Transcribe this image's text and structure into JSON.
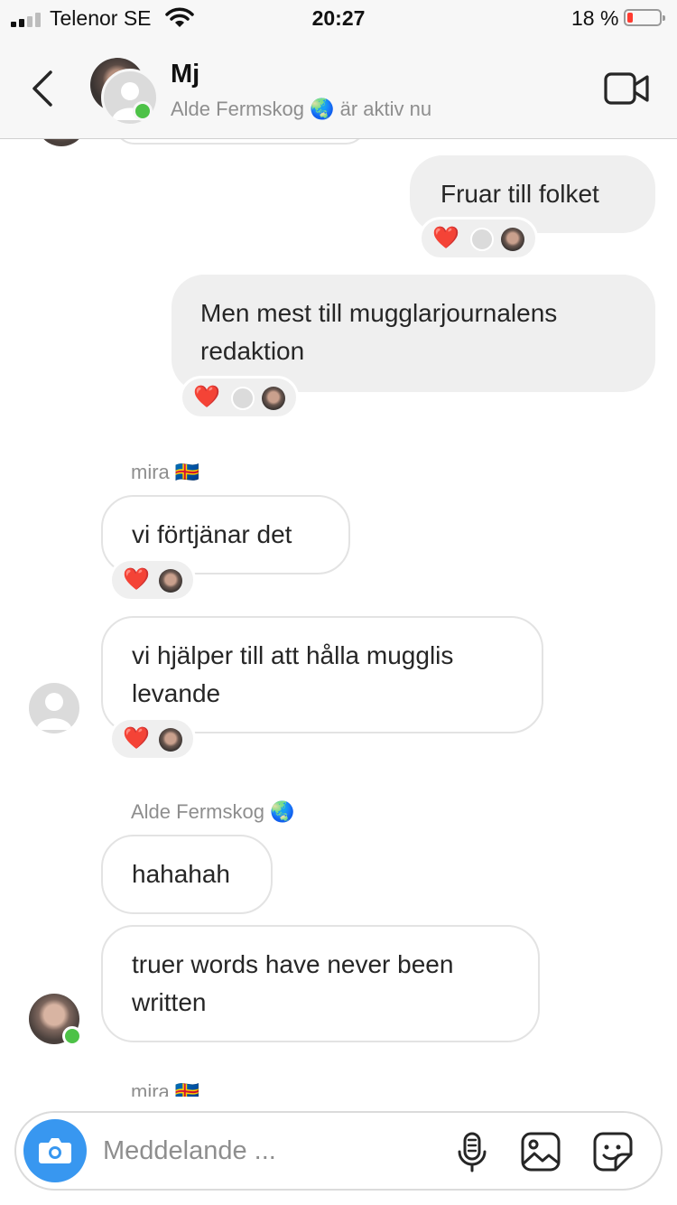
{
  "status_bar": {
    "carrier": "Telenor SE",
    "time": "20:27",
    "battery": "18 %"
  },
  "header": {
    "title": "Mj",
    "subtitle_name": "Alde Fermskog",
    "subtitle_emoji": "🌏",
    "subtitle_status": "är aktiv nu"
  },
  "messages": {
    "out1": "Fruar till folket",
    "out2": "Men mest till mugglarjournalens redaktion",
    "sender1_name": "mira",
    "sender1_flag": "🇦🇽",
    "in1": "vi förtjänar det",
    "in2": "vi hjälper till att hålla mugglis levande",
    "sender2_name": "Alde Fermskog",
    "sender2_emoji": "🌏",
    "in3": "hahahah",
    "in4": "truer words have never been written",
    "sender3_name": "mira",
    "sender3_flag": "🇦🇽",
    "reaction_heart": "❤️"
  },
  "composer": {
    "placeholder": "Meddelande ..."
  },
  "colors": {
    "accent": "#3897f0",
    "online": "#4dc247",
    "heart": "#ed1d3a",
    "battery_low": "#ff3b30"
  }
}
